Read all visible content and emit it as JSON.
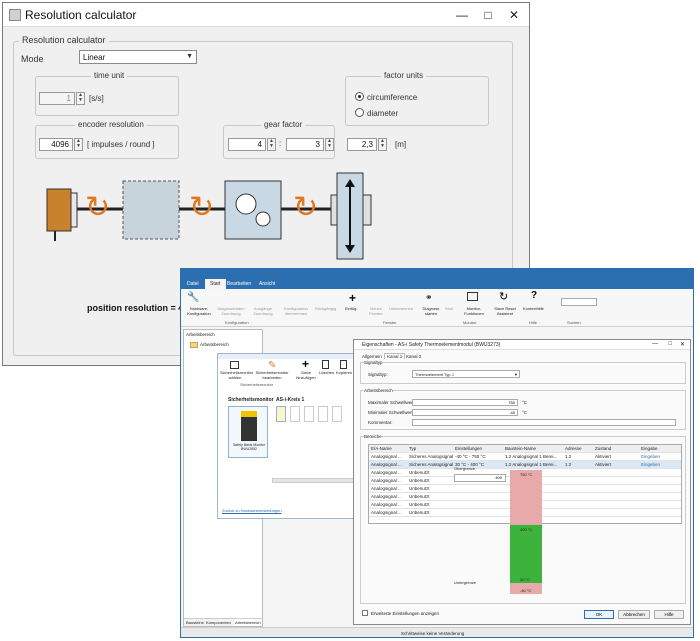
{
  "calc": {
    "title": "Resolution calculator",
    "group_label": "Resolution calculator",
    "mode_label": "Mode",
    "mode_value": "Linear",
    "time_unit": {
      "label": "time unit",
      "value": "1",
      "unit": "[s/s]"
    },
    "factor_units": {
      "label": "factor units",
      "opt1": "circumference",
      "opt2": "diameter",
      "selected": "circumference"
    },
    "encoder": {
      "label": "encoder resolution",
      "value": "4096",
      "unit": "[ impulses / round ]"
    },
    "gear": {
      "label": "gear factor",
      "num": "4",
      "sep": ":",
      "den": "3"
    },
    "factor": {
      "value": "2,3",
      "unit": "[m]"
    },
    "result": "position resolution = 4096 [",
    "colors": {
      "accent": "#e07820",
      "panel": "#f0f0f0"
    }
  },
  "sw": {
    "menu": [
      "Datei",
      "Start",
      "Bearbeiten",
      "Ansicht"
    ],
    "ribbon": [
      "Hardware-Konfiguration",
      "Diagnosedaten Zuordnung",
      "Ausgänge Zuordnung",
      "Konfiguration übernehmen",
      "Rückgängig",
      "Einfüg.",
      "Neues Fenster",
      "Umbenennen",
      "Diagnose starten",
      "Stoll",
      "Monitor-Funktionen",
      "Slave Reset Assistent",
      "Kontexthilfe"
    ],
    "ribbon_groups": [
      "Konfiguration",
      "Fenster",
      "Monitor",
      "Hilfe",
      "Suchen"
    ],
    "left_title": "Arbeitsbereich",
    "left_tabs": [
      "Bausteine",
      "Komponenten",
      "Arbeitsbereich"
    ],
    "tree_item": "Arbeitsbereich",
    "inner": {
      "buttons": [
        "Sicherheitsmonitor wählen",
        "Sicherheitsmonitor bearbeiten",
        "Slave hinzufügen",
        "Löschen",
        "Kopieren"
      ],
      "group": "Sicherheitsmonitor",
      "monitor_title": "Sicherheitsmonitor",
      "kreis_title": "AS-i-Kreis 1",
      "device_caption": "Safety Basis Monitor BWU2852",
      "link": "Zurück zu Hardwareeinstellungen"
    },
    "dialog": {
      "title": "Eigenschaften - AS-i Safety Thermoelementmodul (BWU3273)",
      "tabs": [
        "Allgemein",
        "Kanal 1",
        "Kanal 2"
      ],
      "signaltyp_group": "Signaltyp",
      "signaltyp_label": "Signaltyp:",
      "signaltyp_value": "Thermoelement Typ J",
      "arbeits_group": "Arbeitsbereich",
      "max_label": "Maximaler Schwellwert:",
      "max_value": "750",
      "min_label": "Minimaler Schwellwert:",
      "min_value": "-40",
      "deg": "°C",
      "komm_label": "Kommentar:",
      "bereiche_group": "Bereiche",
      "headers": [
        "E/A-Name",
        "Typ",
        "Einstellungen",
        "Baustein-Name",
        "Adresse",
        "Zustand",
        "Eingabe"
      ],
      "rows": [
        [
          "Analogsignal ...",
          "Sicheres Analogsignal",
          "-40 °C - 750 °C",
          "1.2 Analogsignal 1 Berei...",
          "1.2",
          "Aktiviert",
          "Eingeben"
        ],
        [
          "Analogsignal ...",
          "Sicheres Analogsignal",
          "30 °C - 400 °C",
          "1.2 Analogsignal 1 Berei...",
          "1.2",
          "Aktiviert",
          "Eingeben"
        ],
        [
          "Analogsignal ...",
          "Unbenutzt",
          "",
          "",
          "",
          "",
          ""
        ],
        [
          "Analogsignal ...",
          "Unbenutzt",
          "",
          "",
          "",
          "",
          ""
        ],
        [
          "Analogsignal ...",
          "Unbenutzt",
          "",
          "",
          "",
          "",
          ""
        ],
        [
          "Analogsignal ...",
          "Unbenutzt",
          "",
          "",
          "",
          "",
          ""
        ],
        [
          "Analogsignal ...",
          "Unbenutzt",
          "",
          "",
          "",
          "",
          ""
        ],
        [
          "Analogsignal ...",
          "Unbenutzt",
          "",
          "",
          "",
          "",
          ""
        ]
      ],
      "obergrenze": "Obergrenze",
      "obergrenze_value": "400",
      "untergrenze": "Untergrenze",
      "bar_labels": [
        "750 °C",
        "400 °C",
        "30 °C",
        "-40 °C"
      ],
      "checkbox": "Erweiterte Einstellungen anzeigen",
      "ok": "OK",
      "cancel": "Abbrechen",
      "help": "Hilfe"
    },
    "status": "Schrittweise keine Veränderung"
  }
}
